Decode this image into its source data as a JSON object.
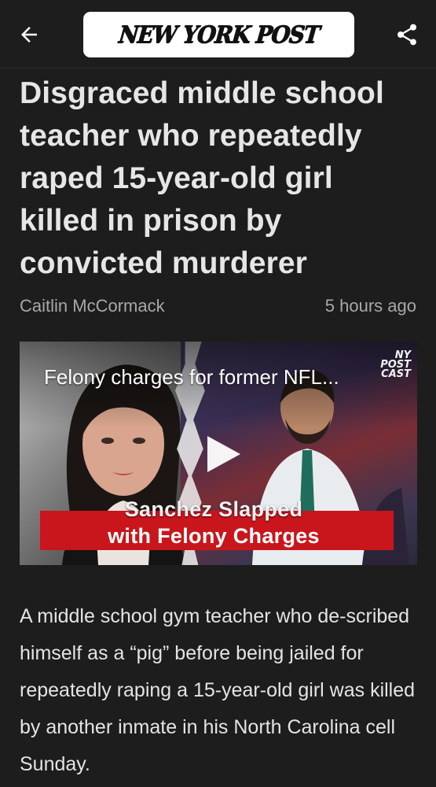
{
  "app": {
    "brand": "NEW YORK POST",
    "colors": {
      "background": "#1d1d1d",
      "logo_bg": "#ffffff",
      "headline": "#e6e6e6",
      "byline": "#a8a8a8",
      "caption_red": "#c9161d"
    }
  },
  "toolbar": {
    "back_icon": "arrow-left-icon",
    "share_icon": "share-icon"
  },
  "article": {
    "headline": "Disgraced middle school teacher who repeatedly raped 15-year-old girl killed in prison by convicted murderer",
    "author": "Caitlin McCormack",
    "timestamp": "5 hours ago",
    "body": "A middle school gym teacher who de-scribed himself as a “pig” before being jailed for repeatedly raping a 15-year-old girl was killed by another inmate in his North Carolina cell Sunday."
  },
  "video": {
    "title": "Felony charges for former NFL...",
    "badge_lines": [
      "NY",
      "POST",
      "CAST"
    ],
    "caption_line1": "Sanchez Slapped",
    "caption_line2": "with Felony Charges",
    "play_icon": "play-icon"
  }
}
